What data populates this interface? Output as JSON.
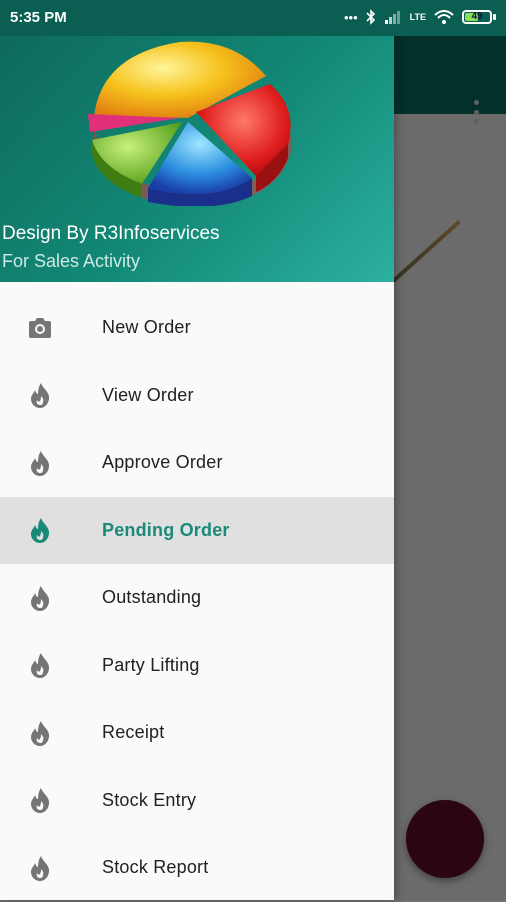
{
  "status_bar": {
    "time": "5:35 PM",
    "network_label": "LTE",
    "battery_level": "49",
    "icons": [
      "dots-icon",
      "bluetooth-icon",
      "signal-icon",
      "lte-icon",
      "wifi-icon",
      "battery-icon"
    ]
  },
  "drawer": {
    "header": {
      "logo": "pie-chart-logo",
      "title": "Design By R3Infoservices",
      "subtitle": "For Sales Activity"
    },
    "items": [
      {
        "label": "New Order",
        "icon": "camera-icon",
        "active": false
      },
      {
        "label": "View Order",
        "icon": "flame-icon",
        "active": false
      },
      {
        "label": "Approve Order",
        "icon": "flame-icon",
        "active": false
      },
      {
        "label": "Pending Order",
        "icon": "flame-icon",
        "active": true
      },
      {
        "label": "Outstanding",
        "icon": "flame-icon",
        "active": false
      },
      {
        "label": "Party Lifting",
        "icon": "flame-icon",
        "active": false
      },
      {
        "label": "Receipt",
        "icon": "flame-icon",
        "active": false
      },
      {
        "label": "Stock Entry",
        "icon": "flame-icon",
        "active": false
      },
      {
        "label": "Stock Report",
        "icon": "flame-icon",
        "active": false
      }
    ]
  },
  "colors": {
    "primary": "#0b6b5d",
    "accent": "#1a8a78",
    "fab": "#d81e5b",
    "active_bg": "#e0e0e0"
  }
}
